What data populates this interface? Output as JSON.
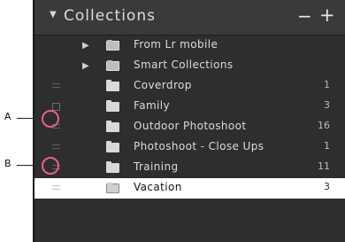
{
  "header": {
    "title": "Collections",
    "collapse_icon": "triangle-down-icon",
    "minus_label": "−",
    "plus_label": "+"
  },
  "callouts": {
    "a": "A",
    "b": "B"
  },
  "collections": [
    {
      "label": "From Lr mobile",
      "type": "set",
      "count": ""
    },
    {
      "label": "Smart Collections",
      "type": "set",
      "count": ""
    },
    {
      "label": "Coverdrop",
      "type": "collection",
      "count": "1",
      "sync": true
    },
    {
      "label": "Family",
      "type": "collection",
      "count": "3",
      "sync": true
    },
    {
      "label": "Outdoor Photoshoot",
      "type": "collection",
      "count": "16",
      "sync": true
    },
    {
      "label": "Photoshoot - Close Ups",
      "type": "collection",
      "count": "1",
      "sync": true
    },
    {
      "label": "Training",
      "type": "collection",
      "count": "11",
      "sync": true
    },
    {
      "label": "Vacation",
      "type": "collection",
      "count": "3",
      "sync": true,
      "selected": true
    }
  ],
  "colors": {
    "panel": "#2e2e2e",
    "header": "#3a3a3a",
    "selected_row": "#ffffff",
    "ring": "#e8608c"
  }
}
